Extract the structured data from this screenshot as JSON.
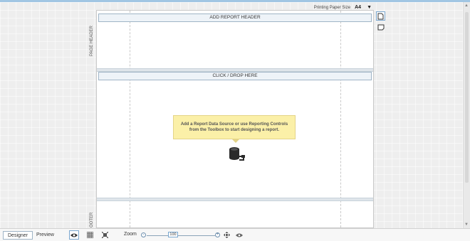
{
  "designer": {
    "paper_size_label": "Printing Paper Size",
    "paper_size_value": "A4",
    "page_header_bar": "ADD REPORT HEADER",
    "page_header_label": "PAGE HEADER",
    "detail_bar": "CLICK / DROP HERE",
    "footer_label": "OOTER",
    "hint_text": "Add a Report Data Source or use Reporting Controls from the Toolbox to start designing a report."
  },
  "status_bar": {
    "tabs": [
      {
        "label": "Designer",
        "active": true
      },
      {
        "label": "Preview",
        "active": false
      }
    ],
    "zoom_label": "Zoom",
    "zoom_value": "100"
  },
  "icons": {
    "hint": "database-link-icon",
    "side": [
      "report-page-icon",
      "report-section-icon"
    ],
    "status": [
      "eye-icon",
      "grid-icon",
      "snap-icon",
      "zoom-in-icon",
      "pan-icon",
      "zoom-eye-icon"
    ]
  },
  "colors": {
    "hint_bg": "#fbf0a8",
    "accent": "#7aa7cf",
    "band_bar_bg": "#eef3f8"
  }
}
